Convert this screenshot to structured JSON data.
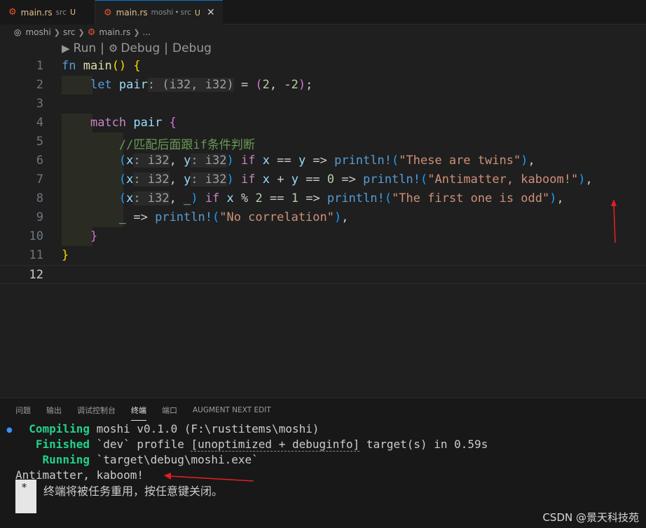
{
  "tabs": [
    {
      "icon": "rust-file-icon",
      "name": "main.rs",
      "desc": "src",
      "status": "U"
    },
    {
      "icon": "rust-file-icon",
      "name": "main.rs",
      "desc": "moshi",
      "desc2": "src",
      "status": "U",
      "close": "✕"
    }
  ],
  "breadcrumb": [
    "moshi",
    "src",
    "main.rs",
    "..."
  ],
  "codelens": {
    "run": "Run",
    "debug1": "Debug",
    "debug2": "Debug"
  },
  "editor": {
    "line_numbers": [
      "1",
      "2",
      "3",
      "4",
      "5",
      "6",
      "7",
      "8",
      "9",
      "10",
      "11",
      "12"
    ],
    "active_line": "12",
    "comment_text": "//匹配后面跟if条件判断",
    "strings": {
      "twins": "\"These are twins\"",
      "antimatter": "\"Antimatter, kaboom!\"",
      "odd": "\"The first one is odd\"",
      "none": "\"No correlation\""
    }
  },
  "panel": {
    "tabs": [
      "问题",
      "输出",
      "调试控制台",
      "终端",
      "端口",
      "AUGMENT NEXT EDIT"
    ],
    "active_tab": "终端"
  },
  "terminal": {
    "compiling_label": "Compiling",
    "compiling_text": " moshi v0.1.0 (F:\\rustitems\\moshi)",
    "finished_label": "Finished",
    "finished_text_1": " `dev` profile ",
    "finished_text_2": "[unoptimized + debuginfo]",
    "finished_text_3": " target(s) in 0.59s",
    "running_label": "Running",
    "running_text": " `target\\debug\\moshi.exe`",
    "output": "Antimatter, kaboom!",
    "reuse_star": "*",
    "reuse_text": "终端将被任务重用，按任意键关闭。"
  },
  "watermark": "CSDN @景天科技苑",
  "colors": {
    "arrow": "#e02020",
    "accent": "#0078d4",
    "terminal_green": "#23d18b"
  }
}
